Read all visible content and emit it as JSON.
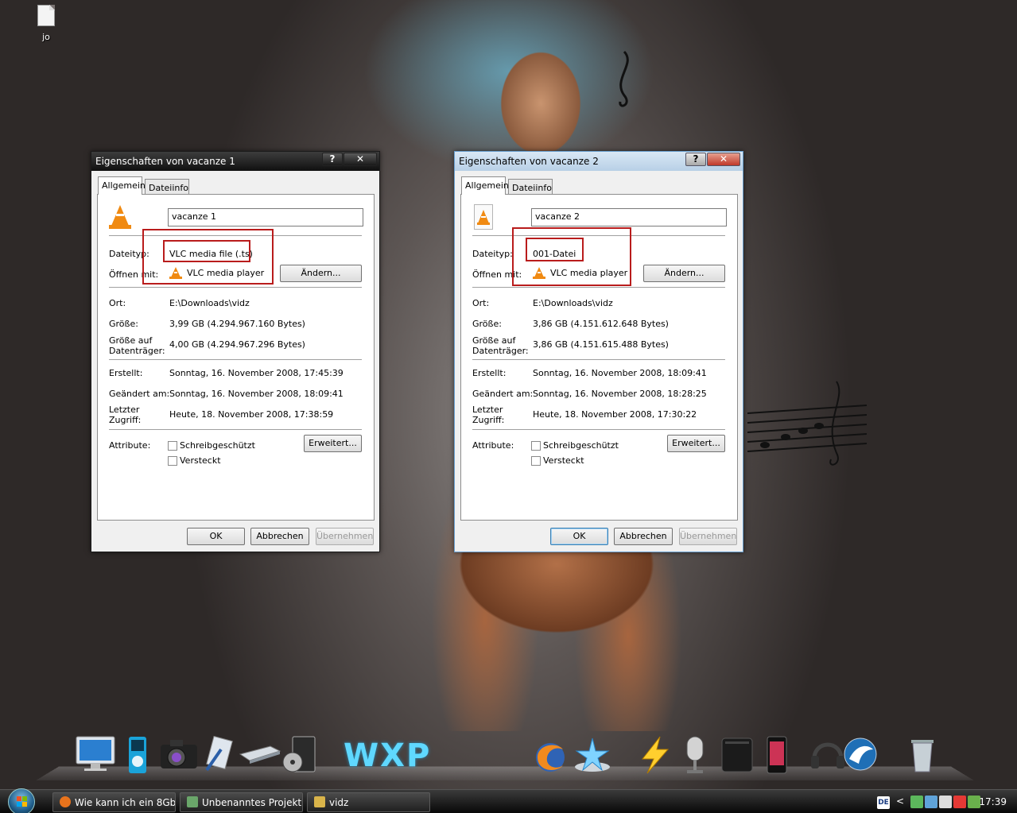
{
  "desktop": {
    "icon_label": "jo"
  },
  "dialogs": [
    {
      "title": "Eigenschaften von vacanze 1",
      "help_glyph": "?",
      "close_glyph": "✕",
      "tabs": [
        "Allgemein",
        "Dateiinfo"
      ],
      "filename": "vacanze 1",
      "type_label": "Dateityp:",
      "type_value": "VLC media file (.ts)",
      "openwith_label": "Öffnen mit:",
      "openwith_value": "VLC media player",
      "change_button": "Ändern...",
      "location_label": "Ort:",
      "location_value": "E:\\Downloads\\vidz",
      "size_label": "Größe:",
      "size_value": "3,99 GB (4.294.967.160 Bytes)",
      "disksize_label_1": "Größe auf",
      "disksize_label_2": "Datenträger:",
      "disksize_value": "4,00 GB (4.294.967.296 Bytes)",
      "created_label": "Erstellt:",
      "created_value": "Sonntag, 16. November 2008, 17:45:39",
      "modified_label": "Geändert am:",
      "modified_value": "Sonntag, 16. November 2008, 18:09:41",
      "accessed_label_1": "Letzter",
      "accessed_label_2": "Zugriff:",
      "accessed_value": "Heute, 18. November 2008, 17:38:59",
      "attributes_label": "Attribute:",
      "readonly_label": "Schreibgeschützt",
      "hidden_label": "Versteckt",
      "advanced_button": "Erweitert...",
      "ok_button": "OK",
      "cancel_button": "Abbrechen",
      "apply_button": "Übernehmen"
    },
    {
      "title": "Eigenschaften von vacanze 2",
      "help_glyph": "?",
      "close_glyph": "✕",
      "tabs": [
        "Allgemein",
        "Dateiinfo"
      ],
      "filename": "vacanze 2",
      "type_label": "Dateityp:",
      "type_value": "001-Datei",
      "openwith_label": "Öffnen mit:",
      "openwith_value": "VLC media player",
      "change_button": "Ändern...",
      "location_label": "Ort:",
      "location_value": "E:\\Downloads\\vidz",
      "size_label": "Größe:",
      "size_value": "3,86 GB (4.151.612.648 Bytes)",
      "disksize_label_1": "Größe auf",
      "disksize_label_2": "Datenträger:",
      "disksize_value": "3,86 GB (4.151.615.488 Bytes)",
      "created_label": "Erstellt:",
      "created_value": "Sonntag, 16. November 2008, 18:09:41",
      "modified_label": "Geändert am:",
      "modified_value": "Sonntag, 16. November 2008, 18:28:25",
      "accessed_label_1": "Letzter",
      "accessed_label_2": "Zugriff:",
      "accessed_value": "Heute, 18. November 2008, 17:30:22",
      "attributes_label": "Attribute:",
      "readonly_label": "Schreibgeschützt",
      "hidden_label": "Versteckt",
      "advanced_button": "Erweitert...",
      "ok_button": "OK",
      "cancel_button": "Abbrechen",
      "apply_button": "Übernehmen"
    }
  ],
  "dock": {
    "logo_text": "WXP",
    "items": [
      "computer-icon",
      "ipod-icon",
      "camera-icon",
      "pen-icon",
      "scanner-icon",
      "media-player-icon",
      "firefox-icon",
      "star-icon",
      "lightning-icon",
      "microphone-icon",
      "ps3-icon",
      "phone-icon",
      "headset-icon",
      "bird-icon",
      "trash-icon"
    ]
  },
  "taskbar": {
    "tasks": [
      {
        "label": "Wie kann ich ein 8Gb...",
        "icon": "firefox-icon",
        "color": "#e8731c"
      },
      {
        "label": "Unbenanntes Projekt...",
        "icon": "project-icon",
        "color": "#6aa66a"
      },
      {
        "label": "vidz",
        "icon": "folder-icon",
        "color": "#d9b44a"
      }
    ],
    "language": "DE",
    "tray_chevron": "<",
    "clock": "17:39"
  },
  "colors": {
    "highlight": "#b91c1c",
    "vlc_orange": "#f08a12"
  }
}
